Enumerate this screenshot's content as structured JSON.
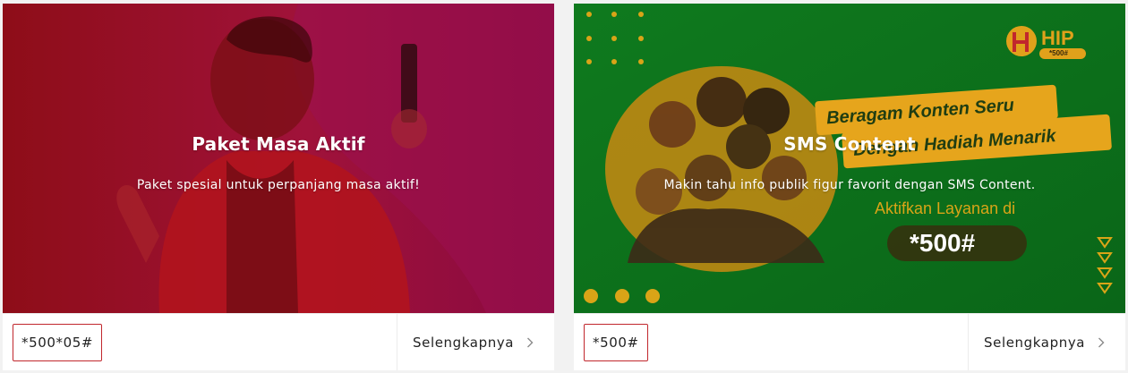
{
  "cards": [
    {
      "title": "Paket Masa Aktif",
      "subtitle": "Paket spesial untuk perpanjang masa aktif!",
      "code": "*500*05#",
      "more_label": "Selengkapnya",
      "accent": "#c1272d"
    },
    {
      "title": "SMS Content",
      "subtitle": "Makin tahu info publik figur favorit dengan SMS Content.",
      "code": "*500#",
      "more_label": "Selengkapnya",
      "accent": "#c1272d",
      "banner": {
        "brand": "HIP",
        "brand_code": "*500#",
        "headline_1": "Beragam Konten Seru",
        "headline_2": "Dengan Hadiah Menarik",
        "cta_text": "Aktifkan Layanan di",
        "cta_code": "*500#"
      }
    }
  ],
  "icons": {
    "chevron": "chevron-right-icon"
  }
}
